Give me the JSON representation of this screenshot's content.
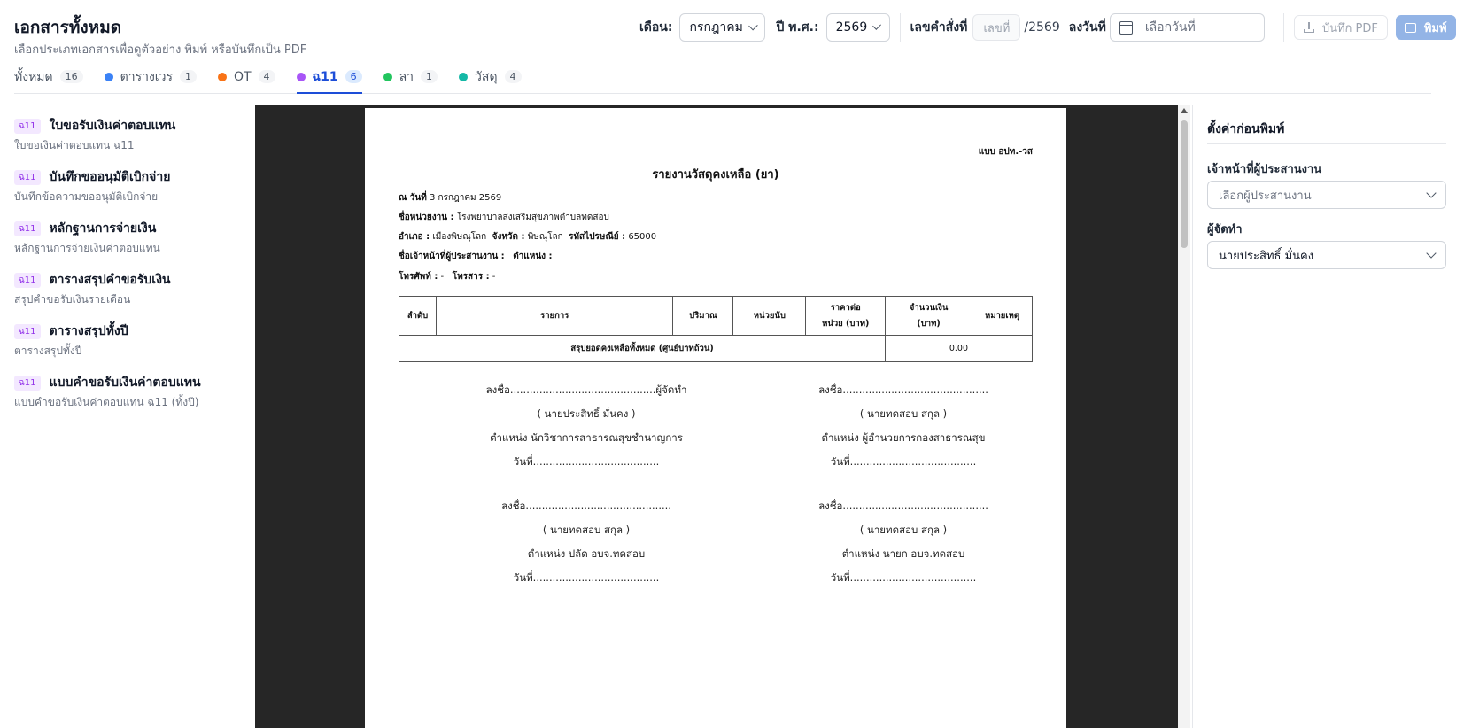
{
  "header": {
    "title": "เอกสารทั้งหมด",
    "subtitle": "เลือกประเภทเอกสารเพื่อดูตัวอย่าง พิมพ์ หรือบันทึกเป็น PDF"
  },
  "controls": {
    "month_label": "เดือน:",
    "month_value": "กรกฎาคม",
    "year_label": "ปี พ.ศ.:",
    "year_value": "2569",
    "order_label": "เลขคำสั่งที่",
    "order_placeholder": "เลขที่",
    "order_suffix": "/2569",
    "date_label": "ลงวันที่",
    "date_placeholder": "เลือกวันที่",
    "pdf_button": "บันทึก PDF",
    "print_button": "พิมพ์"
  },
  "tabs": [
    {
      "label": "ทั้งหมด",
      "count": "16",
      "dot_color": ""
    },
    {
      "label": "ตารางเวร",
      "count": "1",
      "dot_color": "#3b82f6"
    },
    {
      "label": "OT",
      "count": "4",
      "dot_color": "#f97316"
    },
    {
      "label": "ฉ11",
      "count": "6",
      "dot_color": "#a855f7"
    },
    {
      "label": "ลา",
      "count": "1",
      "dot_color": "#22c55e"
    },
    {
      "label": "วัสดุ",
      "count": "4",
      "dot_color": "#14b8a6"
    }
  ],
  "active_tab": "ฉ11",
  "documents": [
    {
      "badge": "ฉ11",
      "title": "ใบขอรับเงินค่าตอบแทน",
      "subtitle": "ใบขอเงินค่าตอบแทน ฉ11"
    },
    {
      "badge": "ฉ11",
      "title": "บันทึกขออนุมัติเบิกจ่าย",
      "subtitle": "บันทึกข้อความขออนุมัติเบิกจ่าย"
    },
    {
      "badge": "ฉ11",
      "title": "หลักฐานการจ่ายเงิน",
      "subtitle": "หลักฐานการจ่ายเงินค่าตอบแทน"
    },
    {
      "badge": "ฉ11",
      "title": "ตารางสรุปคำขอรับเงิน",
      "subtitle": "สรุปคำขอรับเงินรายเดือน"
    },
    {
      "badge": "ฉ11",
      "title": "ตารางสรุปทั้งปี",
      "subtitle": "ตารางสรุปทั้งปี"
    },
    {
      "badge": "ฉ11",
      "title": "แบบคำขอรับเงินค่าตอบแทน",
      "subtitle": "แบบคำขอรับเงินค่าตอบแทน ฉ11 (ทั้งปี)"
    }
  ],
  "report": {
    "form_code": "แบบ อปท.-วส",
    "title": "รายงานวัสดุคงเหลือ (ยา)",
    "date_label": "ณ วันที่",
    "date_value": "3 กรกฎาคม 2569",
    "unit_label": "ชื่อหน่วยงาน :",
    "unit_value": "โรงพยาบาลส่งเสริมสุขภาพตำบลทดสอบ",
    "district_label": "อำเภอ :",
    "district_value": "เมืองพิษณุโลก",
    "province_label": "จังหวัด :",
    "province_value": "พิษณุโลก",
    "postcode_label": "รหัสไปรษณีย์ :",
    "postcode_value": "65000",
    "officer_label": "ชื่อเจ้าหน้าที่ผู้ประสานงาน :",
    "position_label": "ตำแหน่ง :",
    "phone_label": "โทรศัพท์ :",
    "phone_value": "-",
    "fax_label": "โทรสาร :",
    "fax_value": "-",
    "table_headers": {
      "no": "ลำดับ",
      "item": "รายการ",
      "qty": "ปริมาณ",
      "unit": "หน่วยนับ",
      "price_1": "ราคาต่อ",
      "price_2": "หน่วย (บาท)",
      "amount_1": "จำนวนเงิน",
      "amount_2": "(บาท)",
      "note": "หมายเหตุ"
    },
    "summary_label": "สรุปยอดคงเหลือทั้งหมด (ศูนย์บาทถ้วน)",
    "summary_value": "0.00",
    "signatures": [
      {
        "sign": "ลงชื่อ.............................................ผู้จัดทำ",
        "name": "( นายประสิทธิ์ มั่นคง )",
        "position": "ตำแหน่ง นักวิชาการสาธารณสุขชำนาญการ",
        "date": "วันที่......................................."
      },
      {
        "sign": "ลงชื่อ.............................................",
        "name": "( นายทดสอบ สกุล )",
        "position": "ตำแหน่ง ผู้อำนวยการกองสาธารณสุข",
        "date": "วันที่......................................."
      },
      {
        "sign": "ลงชื่อ.............................................",
        "name": "( นายทดสอบ สกุล )",
        "position": "ตำแหน่ง ปลัด อบจ.ทดสอบ",
        "date": "วันที่......................................."
      },
      {
        "sign": "ลงชื่อ.............................................",
        "name": "( นายทดสอบ สกุล )",
        "position": "ตำแหน่ง นายก อบจ.ทดสอบ",
        "date": "วันที่......................................."
      }
    ]
  },
  "settings": {
    "title": "ตั้งค่าก่อนพิมพ์",
    "coordinator_label": "เจ้าหน้าที่ผู้ประสานงาน",
    "coordinator_placeholder": "เลือกผู้ประสานงาน",
    "preparer_label": "ผู้จัดทำ",
    "preparer_value": "นายประสิทธิ์ มั่นคง"
  }
}
